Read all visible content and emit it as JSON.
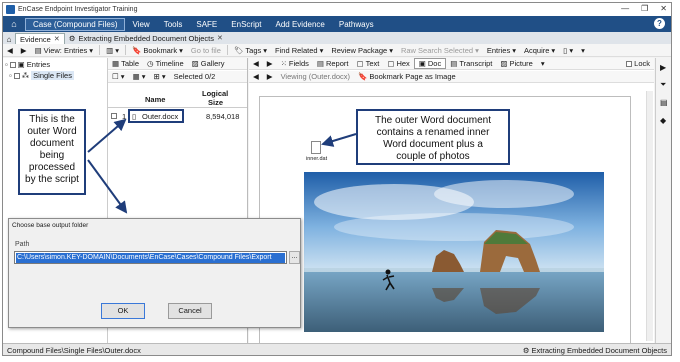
{
  "window": {
    "title": "EnCase Endpoint Investigator Training",
    "minimize": "—",
    "restore": "❐",
    "close": "✕"
  },
  "menubar": {
    "home_icon": "home-icon",
    "items": [
      "Case (Compound Files)",
      "View",
      "Tools",
      "SAFE",
      "EnScript",
      "Add Evidence",
      "Pathways"
    ],
    "help": "?"
  },
  "tabs": [
    {
      "label": "Evidence",
      "close": "✕"
    },
    {
      "label": "Extracting Embedded Document Objects",
      "close": "✕"
    }
  ],
  "main_toolbar": {
    "view_entries": "View: Entries",
    "bookmark": "Bookmark",
    "go_to_file": "Go to file",
    "tags": "Tags",
    "find_related": "Find Related",
    "review_package": "Review Package",
    "raw_search_selected": "Raw Search Selected",
    "entries": "Entries",
    "acquire": "Acquire"
  },
  "tree": {
    "root": "Entries",
    "child": "Single Files"
  },
  "table_panel": {
    "tabs": [
      "Table",
      "Timeline",
      "Gallery"
    ],
    "selected": "Selected 0/2",
    "columns": {
      "name": "Name",
      "size_line1": "Logical",
      "size_line2": "Size"
    },
    "row": {
      "index": "1",
      "name": "Outer.docx",
      "size": "8,594,018"
    }
  },
  "viewer": {
    "tabs": [
      "Fields",
      "Report",
      "Text",
      "Hex",
      "Doc",
      "Transcript",
      "Picture"
    ],
    "lock": "Lock",
    "viewing": "Viewing (Outer.docx)",
    "bookmark_page": "Bookmark Page as Image",
    "inner_file": "inner.dat"
  },
  "dialog": {
    "title": "Choose base output folder",
    "path_label": "Path",
    "path_value": "C:\\Users\\simon.KEY-DOMAIN\\Documents\\EnCase\\Cases\\Compound Files\\Export",
    "browse": "...",
    "ok": "OK",
    "cancel": "Cancel"
  },
  "status": {
    "path": "Compound Files\\Single Files\\Outer.docx",
    "task": "Extracting Embedded Document Objects"
  },
  "callouts": {
    "left": [
      "This is the",
      "outer Word",
      "document",
      "being",
      "processed",
      "by the script"
    ],
    "right": [
      "The outer Word document",
      "contains a renamed inner",
      "Word document plus a",
      "couple of photos"
    ]
  },
  "colors": {
    "menubar": "#204f86",
    "callout_border": "#1f3d7a",
    "selection": "#2a6fd1",
    "highlight_box": "#1f3d7a"
  }
}
